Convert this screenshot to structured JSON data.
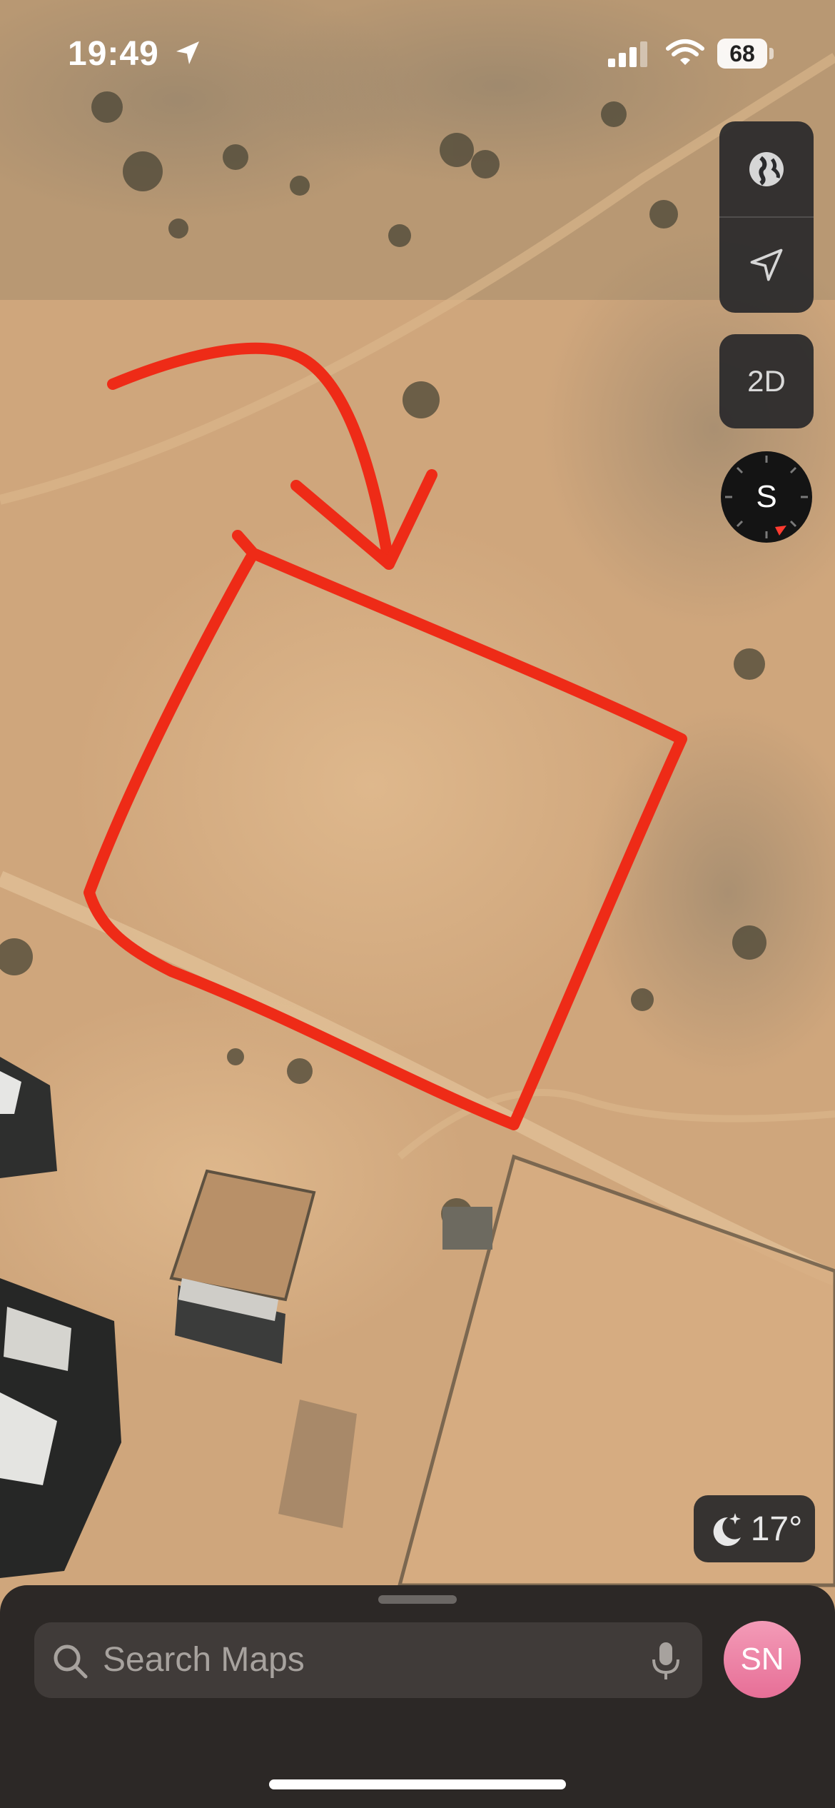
{
  "status_bar": {
    "time": "19:49",
    "battery_level": "68",
    "icons": [
      "location-arrow-icon",
      "cellular-signal-icon",
      "wifi-icon",
      "battery-icon"
    ]
  },
  "map_controls": {
    "map_mode_icon": "globe-icon",
    "locate_icon": "location-arrow-icon",
    "view_toggle_label": "2D",
    "compass_heading": "S"
  },
  "weather": {
    "icon": "moon-stars-icon",
    "temperature": "17°"
  },
  "search": {
    "placeholder": "Search Maps",
    "icons": [
      "search-icon",
      "microphone-icon"
    ]
  },
  "profile": {
    "initials": "SN"
  },
  "annotation": {
    "color": "#ee2b17",
    "shapes": [
      "arrow",
      "rectangle"
    ]
  }
}
